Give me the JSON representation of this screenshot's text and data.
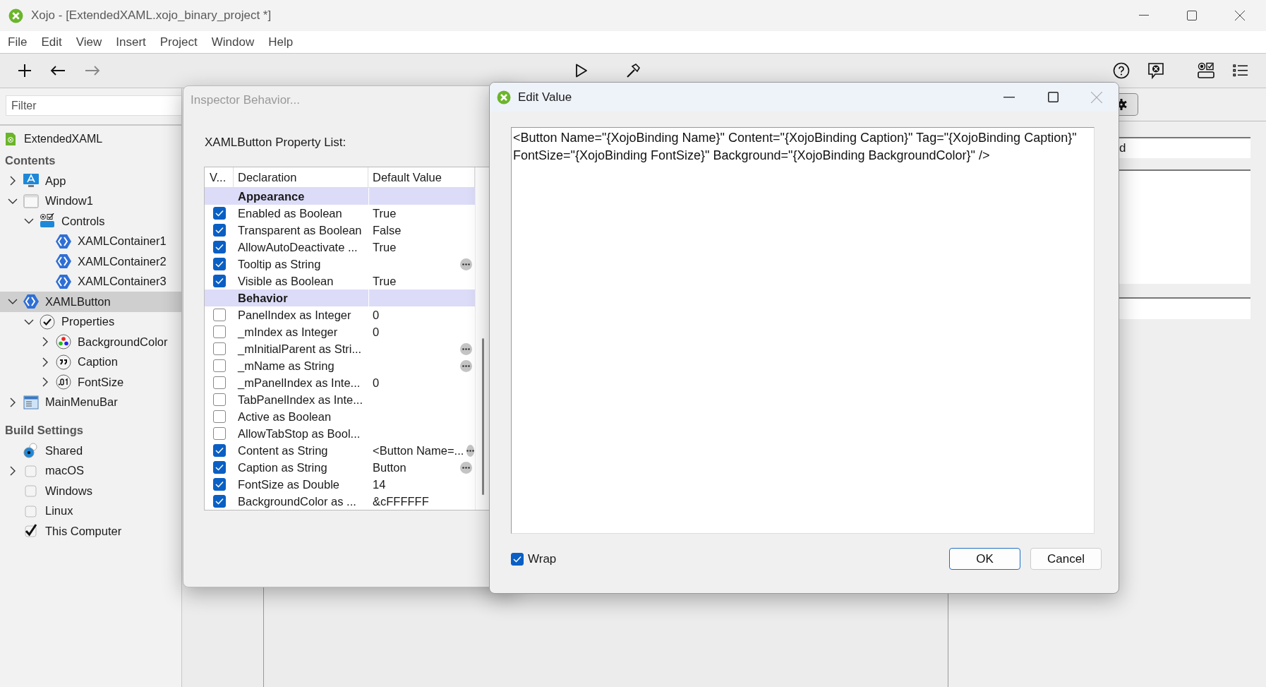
{
  "window": {
    "title": "Xojo - [ExtendedXAML.xojo_binary_project *]"
  },
  "menu": [
    "File",
    "Edit",
    "View",
    "Insert",
    "Project",
    "Window",
    "Help"
  ],
  "navigator": {
    "filter": {
      "placeholder": "Filter"
    },
    "project": "ExtendedXAML",
    "sections": [
      {
        "title": "Contents",
        "items": [
          {
            "label": "App",
            "kind": "app",
            "expanded": false,
            "selected": false
          },
          {
            "label": "Window1",
            "kind": "window",
            "expanded": true,
            "selected": false,
            "children": [
              {
                "label": "Controls",
                "kind": "controls",
                "expanded": true,
                "selected": false,
                "children": [
                  {
                    "label": "XAMLContainer1",
                    "kind": "xaml",
                    "selected": false
                  },
                  {
                    "label": "XAMLContainer2",
                    "kind": "xaml",
                    "selected": false
                  },
                  {
                    "label": "XAMLContainer3",
                    "kind": "xaml",
                    "selected": false
                  }
                ]
              }
            ]
          },
          {
            "label": "XAMLButton",
            "kind": "xaml",
            "expanded": true,
            "selected": true,
            "children": [
              {
                "label": "Properties",
                "kind": "properties",
                "expanded": true,
                "selected": false,
                "children": [
                  {
                    "label": "BackgroundColor",
                    "kind": "color",
                    "expanded": false,
                    "selected": false
                  },
                  {
                    "label": "Caption",
                    "kind": "quote",
                    "expanded": false,
                    "selected": false
                  },
                  {
                    "label": "FontSize",
                    "kind": "number",
                    "expanded": false,
                    "selected": false
                  }
                ]
              }
            ]
          },
          {
            "label": "MainMenuBar",
            "kind": "menubar",
            "expanded": false,
            "selected": false
          }
        ]
      },
      {
        "title": "Build Settings",
        "items": [
          {
            "label": "Shared",
            "kind": "radio",
            "checked": true,
            "selected": false
          },
          {
            "label": "macOS",
            "kind": "checkbox",
            "checked": false,
            "expanded": false,
            "selected": false
          },
          {
            "label": "Windows",
            "kind": "checkbox",
            "checked": false,
            "selected": false
          },
          {
            "label": "Linux",
            "kind": "checkbox",
            "checked": false,
            "selected": false
          },
          {
            "label": "This Computer",
            "kind": "checkbox",
            "checked": true,
            "selected": false
          }
        ]
      }
    ]
  },
  "inspector_dialog": {
    "title": "Inspector Behavior...",
    "heading": "XAMLButton Property List:",
    "columns": [
      "V...",
      "Declaration",
      "Default Value"
    ],
    "rows": [
      {
        "kind": "group",
        "declaration": "Appearance"
      },
      {
        "kind": "property",
        "checked": true,
        "declaration": "Enabled as Boolean",
        "value": "True",
        "more": false
      },
      {
        "kind": "property",
        "checked": true,
        "declaration": "Transparent as Boolean",
        "value": "False",
        "more": false
      },
      {
        "kind": "property",
        "checked": true,
        "declaration": "AllowAutoDeactivate ...",
        "value": "True",
        "more": false
      },
      {
        "kind": "property",
        "checked": true,
        "declaration": "Tooltip as String",
        "more": true
      },
      {
        "kind": "property",
        "checked": true,
        "declaration": "Visible as Boolean",
        "value": "True",
        "more": false
      },
      {
        "kind": "group",
        "declaration": "Behavior"
      },
      {
        "kind": "property",
        "checked": false,
        "declaration": "PanelIndex as Integer",
        "value": "0",
        "more": false
      },
      {
        "kind": "property",
        "checked": false,
        "declaration": "_mIndex as Integer",
        "value": "0",
        "more": false
      },
      {
        "kind": "property",
        "checked": false,
        "declaration": "_mInitialParent as Stri...",
        "more": true
      },
      {
        "kind": "property",
        "checked": false,
        "declaration": "_mName as String",
        "more": true
      },
      {
        "kind": "property",
        "checked": false,
        "declaration": "_mPanelIndex as Inte...",
        "value": "0",
        "more": false
      },
      {
        "kind": "property",
        "checked": false,
        "declaration": "TabPanelIndex as Inte...",
        "more": false
      },
      {
        "kind": "property",
        "checked": false,
        "declaration": "Active as Boolean",
        "more": false
      },
      {
        "kind": "property",
        "checked": false,
        "declaration": "AllowTabStop as Bool...",
        "more": false
      },
      {
        "kind": "property",
        "checked": true,
        "declaration": "Content as String",
        "value": "<Button Name=...",
        "more": true
      },
      {
        "kind": "property",
        "checked": true,
        "declaration": "Caption as String",
        "value": "Button",
        "more": true
      },
      {
        "kind": "property",
        "checked": true,
        "declaration": "FontSize as Double",
        "value": "14",
        "more": false
      },
      {
        "kind": "property",
        "checked": true,
        "declaration": "BackgroundColor as ...",
        "value": "&cFFFFFF",
        "more": false
      }
    ]
  },
  "edit_dialog": {
    "title": "Edit Value",
    "text": "<Button Name=\"{XojoBinding Name}\" Content=\"{XojoBinding Caption}\" Tag=\"{XojoBinding Caption}\" FontSize=\"{XojoBinding FontSize}\" Background=\"{XojoBinding BackgroundColor}\" />",
    "wrap": {
      "label": "Wrap",
      "checked": true
    },
    "buttons": [
      {
        "label": "OK",
        "default": true
      },
      {
        "label": "Cancel",
        "default": false
      }
    ]
  },
  "right_panel": {
    "field_value": "d"
  }
}
